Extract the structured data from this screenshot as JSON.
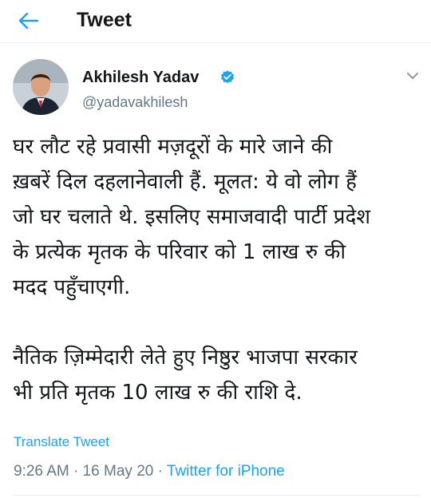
{
  "header": {
    "title": "Tweet",
    "back_icon": "arrow-left-icon"
  },
  "author": {
    "name": "Akhilesh Yadav",
    "handle": "@yadavakhilesh",
    "verified_icon": "verified-badge-icon",
    "menu_icon": "chevron-down-icon"
  },
  "tweet": {
    "paragraph1": [
      "घर लौट रहे प्रवासी मज़दूरों के मारे जाने की",
      "ख़बरें दिल दहलानेवाली हैं. मूलत: ये वो लोग हैं",
      "जो घर चलाते थे. इसलिए समाजवादी पार्टी प्रदेश",
      "के प्रत्येक मृतक के परिवार को 1 लाख रु की",
      "मदद पहुँचाएगी."
    ],
    "paragraph2": [
      "नैतिक ज़िम्मेदारी लेते हुए निष्ठुर भाजपा सरकार",
      "भी प्रति मृतक 10 लाख रु की राशि दे."
    ]
  },
  "translate_label": "Translate Tweet",
  "meta": {
    "time": "9:26 AM",
    "separator": " · ",
    "date": "16 May 20",
    "source": "Twitter for iPhone"
  },
  "colors": {
    "accent": "#1da1f2",
    "text": "#14171a",
    "muted": "#657786"
  }
}
